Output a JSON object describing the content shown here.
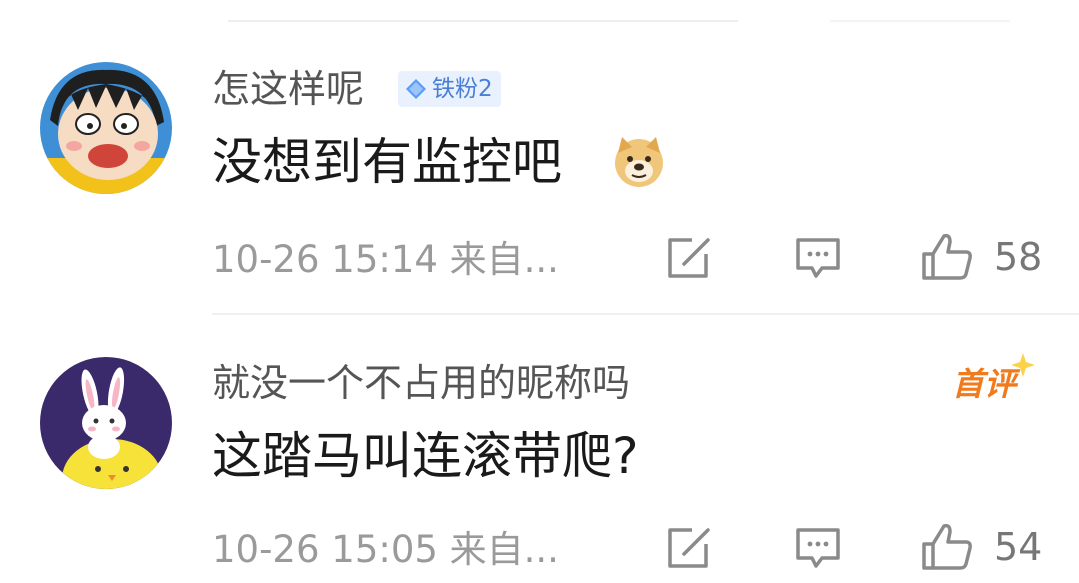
{
  "comments": [
    {
      "username": "怎这样呢",
      "fan_badge": "铁粉2",
      "text": "没想到有监控吧",
      "emoji_icon": "doge-emoji-icon",
      "meta": "10-26 15:14 来自...",
      "likes": "58"
    },
    {
      "username": "就没一个不占用的昵称吗",
      "first_badge": "首评",
      "text": "这踏马叫连滚带爬?",
      "meta": "10-26 15:05 来自...",
      "likes": "54"
    }
  ],
  "colors": {
    "username": "#555555",
    "text": "#1a1a1a",
    "meta": "#9a9a9a",
    "badge_blue": "#4a7fd8",
    "first_orange": "#f07a1c"
  },
  "icons": [
    "share-icon",
    "comment-icon",
    "like-icon"
  ]
}
